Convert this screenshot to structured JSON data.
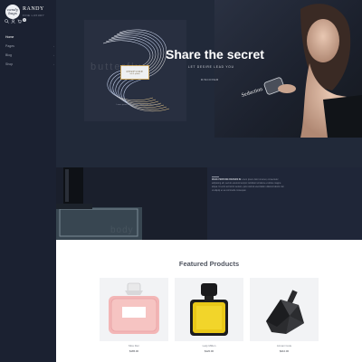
{
  "brand": {
    "logo_text": "candy bags",
    "name": "RANDY",
    "tagline": "FINE LUXURY"
  },
  "header": {
    "cart_count": "0"
  },
  "nav": {
    "items": [
      {
        "label": "Home",
        "has_submenu": false,
        "active": true
      },
      {
        "label": "Pages",
        "has_submenu": true,
        "active": false
      },
      {
        "label": "Blog",
        "has_submenu": true,
        "active": false
      },
      {
        "label": "Shop",
        "has_submenu": true,
        "active": false
      }
    ]
  },
  "hero": {
    "card_label_title": "PERFUME",
    "card_label_sub": "eau de parfum",
    "card_caption": "Lorem ipsum dolor sit amet, consectetur adipiscing elit.",
    "title": "Share the secret",
    "subtitle": "LET DESIRE LEAD YOU",
    "button_label": "DISCOVER",
    "watermark": "butterfly"
  },
  "about": {
    "heading": "MAKE PERFUME BRANDS IN",
    "body": "Lorem ipsum dolor sit amet, consectetur adipiscing elit, sed do eiusmod tempor incididunt ut labore et dolore magna aliqua. Ut enim ad minim veniam, quis nostrud exercitation ullamco laboris nisi ut aliquip ex ea commodo consequat.",
    "watermark": "body"
  },
  "featured": {
    "title": "Featured Products",
    "products": [
      {
        "name": "Miss Dior",
        "price": "$185.00",
        "icon": "pink-perfume-bottle"
      },
      {
        "name": "Lady Million",
        "price": "$120.00",
        "icon": "yellow-perfume-bottle"
      },
      {
        "name": "Armani Code",
        "price": "$210.00",
        "icon": "black-perfume-bottle"
      }
    ]
  },
  "colors": {
    "sidebar_bg": "#1b2131",
    "page_bg": "#1f2638",
    "hero_card_bg": "#282f40",
    "featured_bg": "#ffffff",
    "accent_gold": "#c9a45c"
  }
}
